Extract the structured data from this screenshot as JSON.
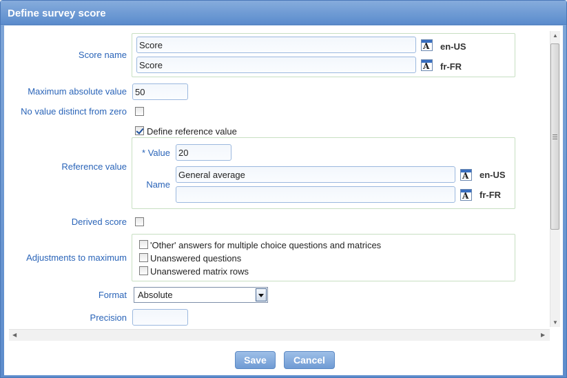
{
  "dialog": {
    "title": "Define survey score"
  },
  "score_name": {
    "label": "Score name",
    "entries": [
      {
        "value": "Score",
        "lang": "en-US"
      },
      {
        "value": "Score",
        "lang": "fr-FR"
      }
    ]
  },
  "max_abs": {
    "label": "Maximum absolute value",
    "value": "50"
  },
  "no_value_distinct": {
    "label": "No value distinct from zero",
    "checked": false
  },
  "define_ref": {
    "label": "Define reference value",
    "checked": true
  },
  "reference": {
    "label": "Reference value",
    "value_label": "* Value",
    "value": "20",
    "name_label": "Name",
    "names": [
      {
        "value": "General average",
        "lang": "en-US"
      },
      {
        "value": "",
        "lang": "fr-FR"
      }
    ]
  },
  "derived": {
    "label": "Derived score",
    "checked": false
  },
  "adjust": {
    "label": "Adjustments to maximum",
    "options": [
      "'Other' answers for multiple choice questions and matrices",
      "Unanswered questions",
      "Unanswered matrix rows"
    ]
  },
  "format": {
    "label": "Format",
    "value": "Absolute"
  },
  "precision": {
    "label": "Precision",
    "value": ""
  },
  "footer": {
    "save": "Save",
    "cancel": "Cancel"
  },
  "icons": {
    "translate": "translate-icon"
  },
  "colors": {
    "label_blue": "#2a64b8",
    "title_bar": "#6b98d2",
    "group_border": "#c7dfc2"
  }
}
